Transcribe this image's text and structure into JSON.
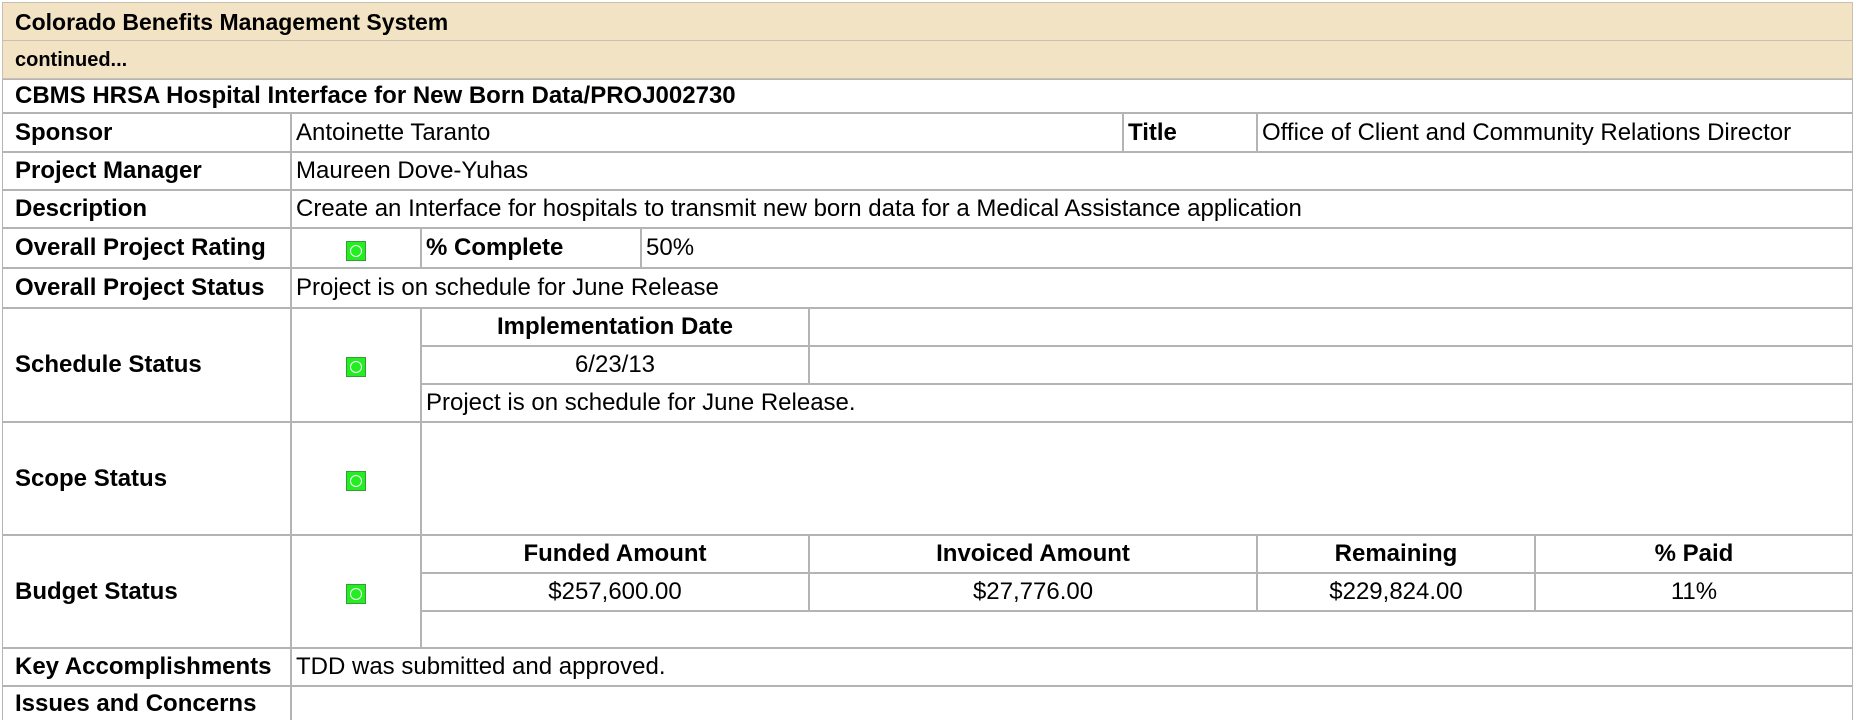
{
  "header": {
    "title": "Colorado Benefits Management System",
    "continued": "continued..."
  },
  "project": {
    "name": "CBMS HRSA Hospital Interface for New Born Data/PROJ002730",
    "sponsor_label": "Sponsor",
    "sponsor": "Antoinette Taranto",
    "title_label": "Title",
    "title": "Office of Client and Community Relations Director",
    "pm_label": "Project Manager",
    "pm": "Maureen Dove-Yuhas",
    "description_label": "Description",
    "description": "Create an Interface for hospitals to transmit new born data for a Medical Assistance application",
    "rating_label": "Overall Project Rating",
    "rating_indicator": "green",
    "complete_label": "% Complete",
    "complete": "50%",
    "status_label": "Overall Project Status",
    "status": "Project is on schedule for June Release"
  },
  "schedule": {
    "label": "Schedule Status",
    "indicator": "green",
    "impl_date_label": "Implementation Date",
    "impl_date": "6/23/13",
    "note": "Project is on schedule for June Release."
  },
  "scope": {
    "label": "Scope Status",
    "indicator": "green"
  },
  "budget": {
    "label": "Budget Status",
    "indicator": "green",
    "funded_label": "Funded Amount",
    "funded": "$257,600.00",
    "invoiced_label": "Invoiced Amount",
    "invoiced": "$27,776.00",
    "remaining_label": "Remaining",
    "remaining": "$229,824.00",
    "paid_label": "% Paid",
    "paid": "11%"
  },
  "accomplishments": {
    "label": "Key Accomplishments",
    "value": "TDD was submitted and approved."
  },
  "issues": {
    "label": "Issues and Concerns"
  },
  "colors": {
    "header_bg": "#f2e3c4",
    "status_green": "#22ee22"
  }
}
